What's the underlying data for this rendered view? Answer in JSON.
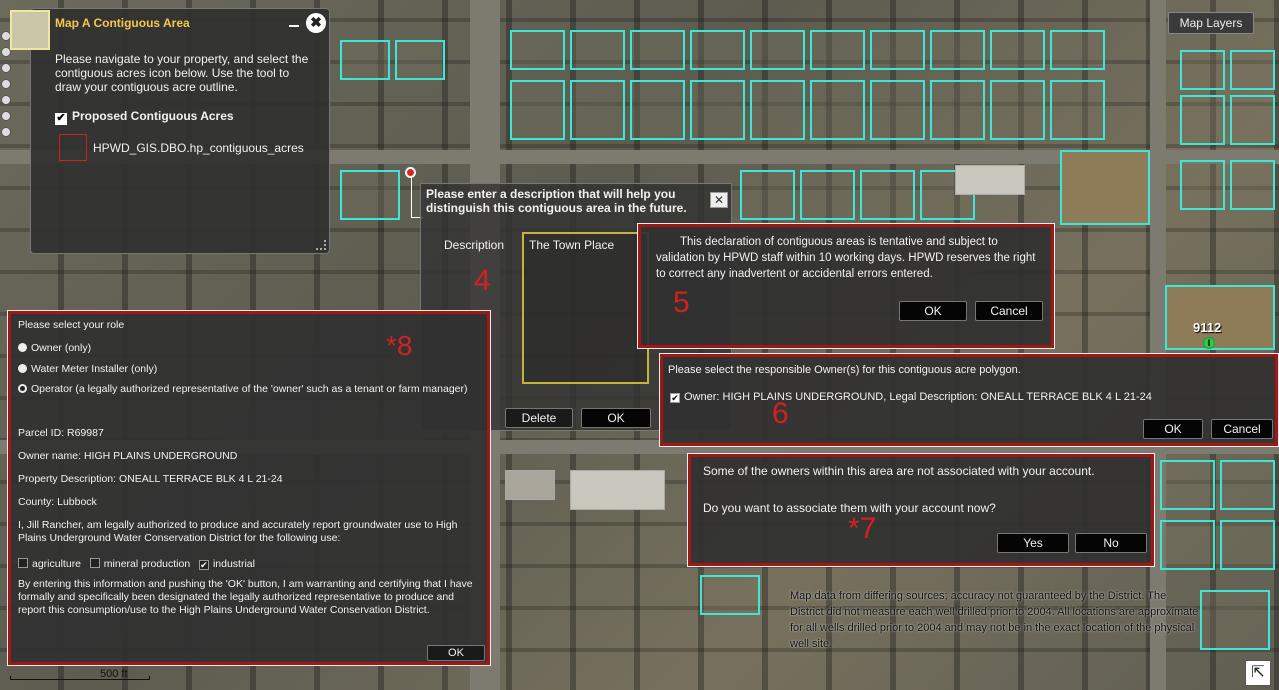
{
  "map": {
    "layers_button": "Map Layers",
    "well_label": "9112",
    "well_marker": "I",
    "disclaimer": "Map data from differing sources; accuracy not guaranteed by the District. The District did not measure each well drilled prior to 2004. All locations are approximate for all wells drilled prior to 2004 and may not be in the exact location of the physical well site.",
    "scale_label": "500 ft",
    "corner_icon": "expand-icon"
  },
  "widget": {
    "title": "Map A Contiguous Area",
    "minimize_icon": "minimize-icon",
    "close_glyph": "✖",
    "intro": "Please navigate to your property, and select the contiguous acres icon below.  Use the tool to draw your contiguous acre outline.",
    "layer_check": "✔",
    "layer_title": "Proposed Contiguous Acres",
    "layer_name": "HPWD_GIS.DBO.hp_contiguous_acres"
  },
  "description_popup": {
    "prompt": "Please enter a description that will help you distinguish this contiguous area in the future.",
    "close_glyph": "✕",
    "label": "Description",
    "value": "The Town Place",
    "delete_button": "Delete",
    "ok_button": "OK",
    "annotation": "4"
  },
  "role_panel": {
    "heading": "Please select your role",
    "roles": [
      "Owner (only)",
      "Water Meter Installer (only)",
      "Operator (a legally authorized representative of the 'owner' such as a tenant or farm manager)"
    ],
    "selected_role_index": 2,
    "parcel_id": "Parcel ID: R69987",
    "owner_name": "Owner name: HIGH PLAINS UNDERGROUND",
    "property_description": "Property Description: ONEALL TERRACE BLK 4 L 21-24",
    "county": "County: Lubbock",
    "authorization": "I, Jill Rancher, am legally authorized to produce and accurately report groundwater use to High Plains Underground Water Conservation District for the following use:",
    "uses": [
      {
        "label": "agriculture",
        "checked": false
      },
      {
        "label": "mineral production",
        "checked": false
      },
      {
        "label": "industrial",
        "checked": true
      }
    ],
    "certification": "By entering this information and pushing the 'OK' button, I am warranting and certifying that I have formally and specifically been designated the legally authorized representative to produce and report this consumption/use to the High Plains Underground Water Conservation District.",
    "ok_button": "OK",
    "annotation": "*8"
  },
  "tentative_panel": {
    "message": "This declaration of contiguous areas is tentative and subject to validation by HPWD staff within 10 working days. HPWD reserves the right to correct any inadvertent or accidental errors entered.",
    "ok_button": "OK",
    "cancel_button": "Cancel",
    "annotation": "5"
  },
  "owners_panel": {
    "heading": "Please select the responsible Owner(s) for this contiguous acre polygon.",
    "check": "✔",
    "owner_entry": "Owner: HIGH PLAINS UNDERGROUND, Legal Description: ONEALL TERRACE BLK 4 L 21-24",
    "ok_button": "OK",
    "cancel_button": "Cancel",
    "annotation": "6"
  },
  "associate_panel": {
    "message": "Some of the owners within this area are not associated with your account.",
    "question": "Do you want to associate them with your account now?",
    "yes_button": "Yes",
    "no_button": "No",
    "annotation": "*7"
  }
}
